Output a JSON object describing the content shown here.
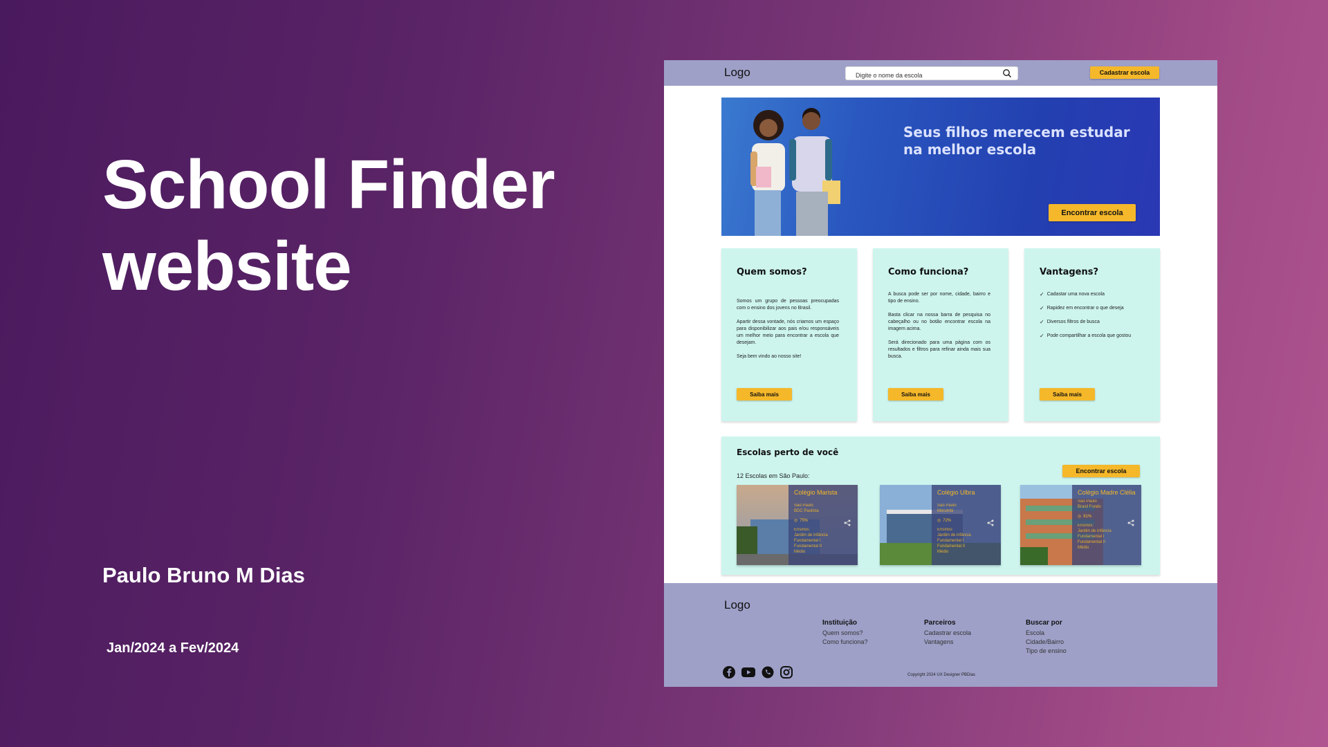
{
  "slide": {
    "title_line1": "School Finder",
    "title_line2": "website",
    "author": "Paulo Bruno M Dias",
    "period": "Jan/2024 a Fev/2024"
  },
  "header": {
    "logo": "Logo",
    "search_placeholder": "Digite o nome da escola",
    "register_button": "Cadastrar escola"
  },
  "hero": {
    "headline_line1": "Seus filhos merecem estudar",
    "headline_line2": "na melhor escola",
    "button": "Encontrar escola"
  },
  "cards": [
    {
      "title": "Quem somos?",
      "paragraphs": [
        "Somos um grupo de pessoas preocupadas com o ensino dos jovens no Brasil.",
        "Apartir dessa vontade, nós criamos um espaço para disponibilizar aos pais e/ou responsáveis um melhor meio para encontrar a escola que desejam.",
        "Seja bem vindo ao nosso site!"
      ],
      "button": "Saiba mais"
    },
    {
      "title": "Como funciona?",
      "paragraphs": [
        "A busca pode ser por nome, cidade, bairro e tipo de ensino.",
        "Basta clicar na nossa barra de pesquisa no cabeçalho ou no botão encontrar escola na imagem acima.",
        "Será direcionado para uma página com os resultados e filtros para refinar ainda mais sua busca."
      ],
      "button": "Saiba mais"
    },
    {
      "title": "Vantagens?",
      "items": [
        "Cadastar uma nova escola",
        "Rapidez em encontrar o que deseja",
        "Diversos filtros de busca",
        "Pode compartilhar a escola que gostou"
      ],
      "button": "Saiba mais"
    }
  ],
  "nearby": {
    "title": "Escolas perto de você",
    "count": "12 Escolas em São Paulo:",
    "button": "Encontrar escola",
    "schools": [
      {
        "name": "Colégio Marista",
        "location": "São Paulo\nBDC Paulista",
        "rating": "75%",
        "ensino": "Ensinos:\nJardim de infância\nFundamental I\nFundamental II\nMédio"
      },
      {
        "name": "Colégio Ulbra",
        "location": "São Paulo\nMorumbi",
        "rating": "72%",
        "ensino": "Ensinos:\nJardim de infância\nFundamental I\nFundamental II\nMédio"
      },
      {
        "name": "Colégio Madre Clélia",
        "location": "São Paulo\nBrasil Fundo",
        "rating": "81%",
        "ensino": "Ensinos:\nJardim de infância\nFundamental I\nFundamental II\nMédio"
      }
    ]
  },
  "footer": {
    "logo": "Logo",
    "columns": [
      {
        "title": "Instituição",
        "links": [
          "Quem somos?",
          "Como funciona?"
        ]
      },
      {
        "title": "Parceiros",
        "links": [
          "Cadastrar escola",
          "Vantagens"
        ]
      },
      {
        "title": "Buscar por",
        "links": [
          "Escola",
          "Cidade/Bairro",
          "Tipo de  ensino"
        ]
      }
    ],
    "social_icons": [
      "facebook-icon",
      "youtube-icon",
      "whatsapp-icon",
      "instagram-icon"
    ],
    "copyright": "Copyright 2024 UX Designer PBDias"
  },
  "colors": {
    "accent": "#f5b82a",
    "header_bg": "#9ea0c8",
    "card_bg": "#cdf5ee",
    "hero_blue": "#2a48b8"
  }
}
